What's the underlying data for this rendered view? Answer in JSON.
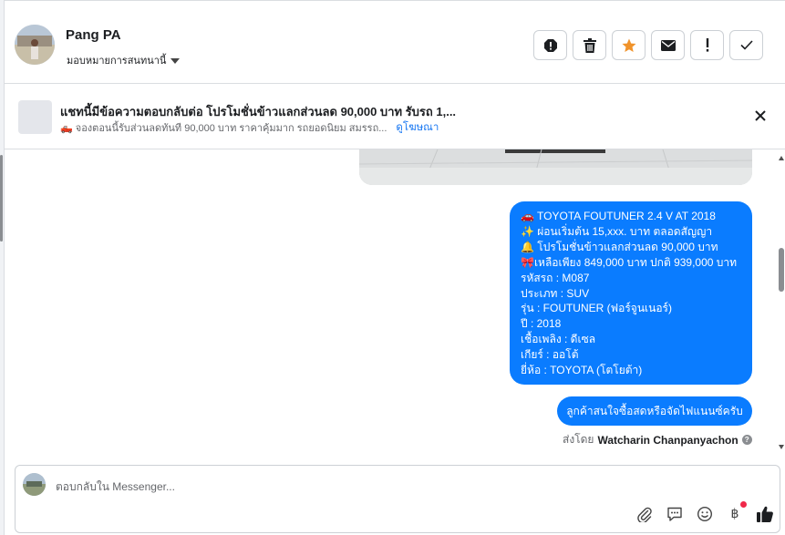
{
  "header": {
    "contact_name": "Pang PA",
    "assign_label": "มอบหมายการสนทนานี้",
    "actions": [
      {
        "name": "report-icon"
      },
      {
        "name": "trash-icon"
      },
      {
        "name": "star-icon"
      },
      {
        "name": "envelope-icon"
      },
      {
        "name": "exclamation-icon"
      },
      {
        "name": "checkmark-icon"
      }
    ]
  },
  "ad_banner": {
    "title": "แชทนี้มีข้อความตอบกลับต่อ โปรโมชั่นข้าวแลกส่วนลด 90,000 บาท รับรถ 1,...",
    "subtitle": "🛻 จองตอนนี้รับส่วนลดทันที 90,000 บาท ราคาคุ้มมาก รถยอดนิยม สมรรถ...",
    "link_label": "ดูโฆษณา"
  },
  "conversation": {
    "message_lines": [
      "🚗 TOYOTA FOUTUNER  2.4 V AT 2018",
      "✨ ผ่อนเริ่มต้น 15,xxx. บาท ตลอดสัญญา",
      "🔔 โปรโมชั่นข้าวแลกส่วนลด 90,000 บาท",
      "🎀เหลือเพียง 849,000 บาท ปกติ 939,000 บาท",
      "รหัสรถ : M087",
      "ประเภท : SUV",
      "รุ่น : FOUTUNER (ฟอร์จูนเนอร์)",
      "ปี : 2018",
      "เชื้อเพลิง : ดีเซล",
      "เกียร์ : ออโต้",
      "ยี่ห้อ : TOYOTA (โตโยต้า)"
    ],
    "reply_message": "ลูกค้าสนใจซื้อสดหรือจัดไฟแนนซ์ครับ",
    "sent_by_prefix": "ส่งโดย",
    "sent_by_name": "Watcharin Chanpanyachon"
  },
  "composer": {
    "placeholder": "ตอบกลับใน Messenger...",
    "baht_symbol": "฿"
  },
  "colors": {
    "bubble": "#0a7cff",
    "link": "#1877f2",
    "star": "#f0932b",
    "notification": "#f02849",
    "like": "#1c1e21"
  }
}
